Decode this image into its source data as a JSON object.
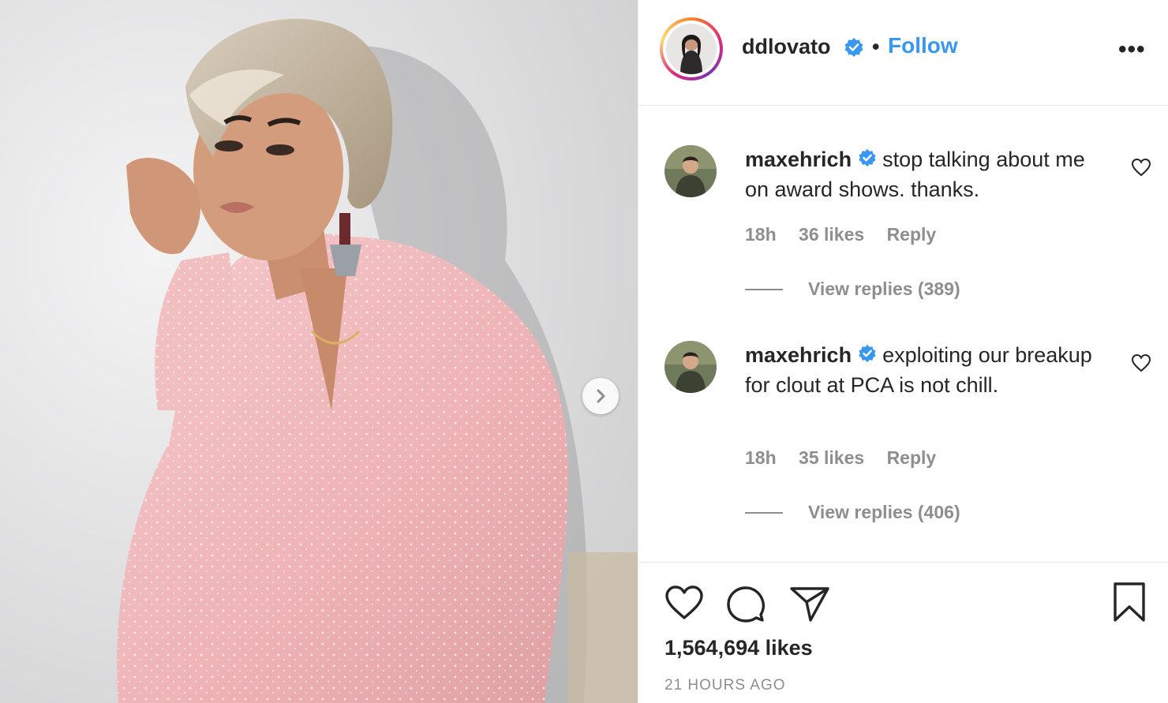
{
  "post": {
    "author": "ddlovato",
    "follow_label": "Follow",
    "separator": "•",
    "more_label": "•••",
    "likes_text": "1,564,694 likes",
    "time_ago": "21 HOURS AGO"
  },
  "comments": [
    {
      "user": "maxehrich",
      "text": "stop talking about me on award shows. thanks.",
      "time": "18h",
      "likes": "36 likes",
      "reply_label": "Reply",
      "view_replies": "View replies (389)"
    },
    {
      "user": "maxehrich",
      "text": "exploiting our breakup for clout at PCA is not chill.",
      "time": "18h",
      "likes": "35 likes",
      "reply_label": "Reply",
      "view_replies": "View replies (406)"
    }
  ],
  "colors": {
    "accent": "#3897f0",
    "verified": "#3897f0",
    "text": "#262626",
    "muted": "#8e8e8e",
    "outfit_pink": "#f0b8bb"
  },
  "icons": {
    "next": "chevron-right-icon",
    "like": "heart-icon",
    "comment": "comment-bubble-icon",
    "share": "paper-plane-icon",
    "save": "bookmark-icon",
    "verified": "verified-badge-icon"
  }
}
